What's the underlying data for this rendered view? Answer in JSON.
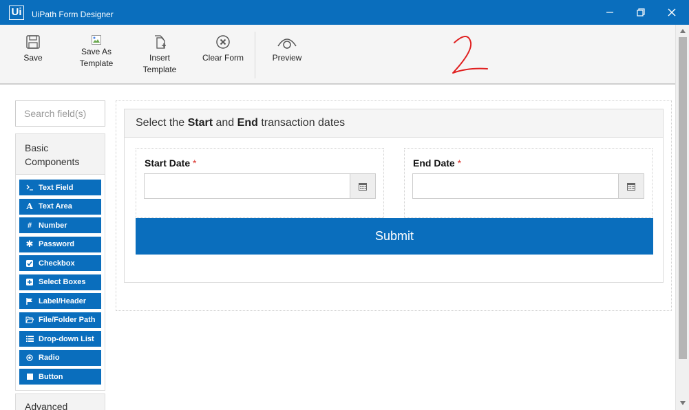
{
  "window": {
    "app_logo": "Ui",
    "title": "UiPath Form Designer"
  },
  "toolbar": {
    "save": "Save",
    "save_as_template": [
      "Save As",
      "Template"
    ],
    "insert_template": [
      "Insert",
      "Template"
    ],
    "clear_form": "Clear Form",
    "preview": "Preview"
  },
  "sidebar": {
    "search_placeholder": "Search field(s)",
    "basic_group": [
      "Basic",
      "Components"
    ],
    "components": [
      {
        "label": "Text Field",
        "icon": "terminal-icon"
      },
      {
        "label": "Text Area",
        "icon": "font-icon"
      },
      {
        "label": "Number",
        "icon": "hash-icon"
      },
      {
        "label": "Password",
        "icon": "asterisk-icon"
      },
      {
        "label": "Checkbox",
        "icon": "check-square-icon"
      },
      {
        "label": "Select Boxes",
        "icon": "plus-square-icon"
      },
      {
        "label": "Label/Header",
        "icon": "flag-icon"
      },
      {
        "label": "File/Folder Path",
        "icon": "folder-open-icon"
      },
      {
        "label": "Drop-down List",
        "icon": "list-icon"
      },
      {
        "label": "Radio",
        "icon": "dot-circle-icon"
      },
      {
        "label": "Button",
        "icon": "stop-icon"
      }
    ],
    "advanced_group": "Advanced"
  },
  "form": {
    "heading": {
      "pre": "Select the ",
      "b1": "Start",
      "mid": " and ",
      "b2": "End",
      "post": " transaction dates"
    },
    "start_date": {
      "label": "Start Date",
      "required": "*"
    },
    "end_date": {
      "label": "End Date",
      "required": "*"
    },
    "submit": "Submit"
  },
  "annotation": "2",
  "colors": {
    "accent": "#0a6ebd",
    "required": "#d9312a",
    "annotation": "#e02020"
  }
}
